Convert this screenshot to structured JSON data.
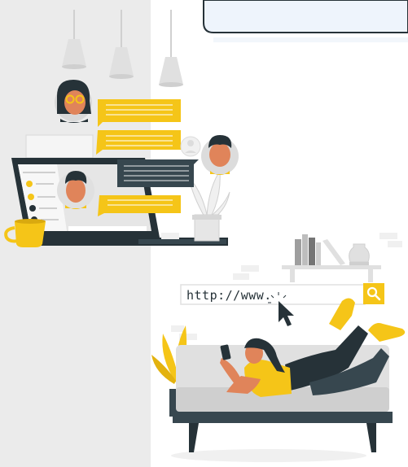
{
  "search_bar": {
    "url_text": "http://www."
  },
  "colors": {
    "accent": "#f5c518",
    "dark": "#263238",
    "left_panel": "#ebebeb",
    "card_fill": "#eef4fc"
  },
  "icons": [
    "lamp-icon",
    "search-icon",
    "cursor-icon",
    "coffee-cup-icon",
    "plant-icon",
    "vase-icon",
    "book-icon",
    "phone-icon"
  ]
}
